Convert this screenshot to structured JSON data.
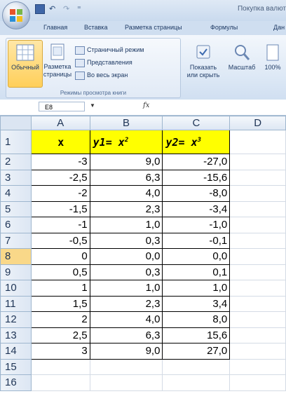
{
  "title_bar": {
    "title": "Покупка валют",
    "quick_access": {
      "undo": "↶",
      "redo": "↷",
      "more": "⁼"
    }
  },
  "tabs": [
    "Главная",
    "Вставка",
    "Разметка страницы",
    "Формулы",
    "Дан"
  ],
  "ribbon": {
    "views_group": {
      "normal": "Обычный",
      "page_layout_line1": "Разметка",
      "page_layout_line2": "страницы",
      "page_mode": "Страничный режим",
      "representations": "Представления",
      "full_screen": "Во весь экран",
      "group_label": "Режимы просмотра книги"
    },
    "show_hide_line1": "Показать",
    "show_hide_line2": "или скрыть",
    "zoom": "Масштаб",
    "zoom_100": "100%"
  },
  "formula_bar": {
    "name_box": "E8",
    "fx": "fx",
    "formula": ""
  },
  "columns": [
    "A",
    "B",
    "C",
    "D"
  ],
  "active_cell": {
    "row": "8",
    "column": "E"
  },
  "header_row": {
    "x": "x",
    "y1_text": "y1= x",
    "y1_exp": "2",
    "y2_text": "y2= x",
    "y2_exp": "3"
  },
  "rows": [
    {
      "row": "1"
    },
    {
      "row": "2",
      "a": "-3",
      "b": "9,0",
      "c": "-27,0"
    },
    {
      "row": "3",
      "a": "-2,5",
      "b": "6,3",
      "c": "-15,6"
    },
    {
      "row": "4",
      "a": "-2",
      "b": "4,0",
      "c": "-8,0"
    },
    {
      "row": "5",
      "a": "-1,5",
      "b": "2,3",
      "c": "-3,4"
    },
    {
      "row": "6",
      "a": "-1",
      "b": "1,0",
      "c": "-1,0"
    },
    {
      "row": "7",
      "a": "-0,5",
      "b": "0,3",
      "c": "-0,1"
    },
    {
      "row": "8",
      "a": "0",
      "b": "0,0",
      "c": "0,0"
    },
    {
      "row": "9",
      "a": "0,5",
      "b": "0,3",
      "c": "0,1"
    },
    {
      "row": "10",
      "a": "1",
      "b": "1,0",
      "c": "1,0"
    },
    {
      "row": "11",
      "a": "1,5",
      "b": "2,3",
      "c": "3,4"
    },
    {
      "row": "12",
      "a": "2",
      "b": "4,0",
      "c": "8,0"
    },
    {
      "row": "13",
      "a": "2,5",
      "b": "6,3",
      "c": "15,6"
    },
    {
      "row": "14",
      "a": "3",
      "b": "9,0",
      "c": "27,0"
    },
    {
      "row": "15"
    },
    {
      "row": "16"
    }
  ]
}
